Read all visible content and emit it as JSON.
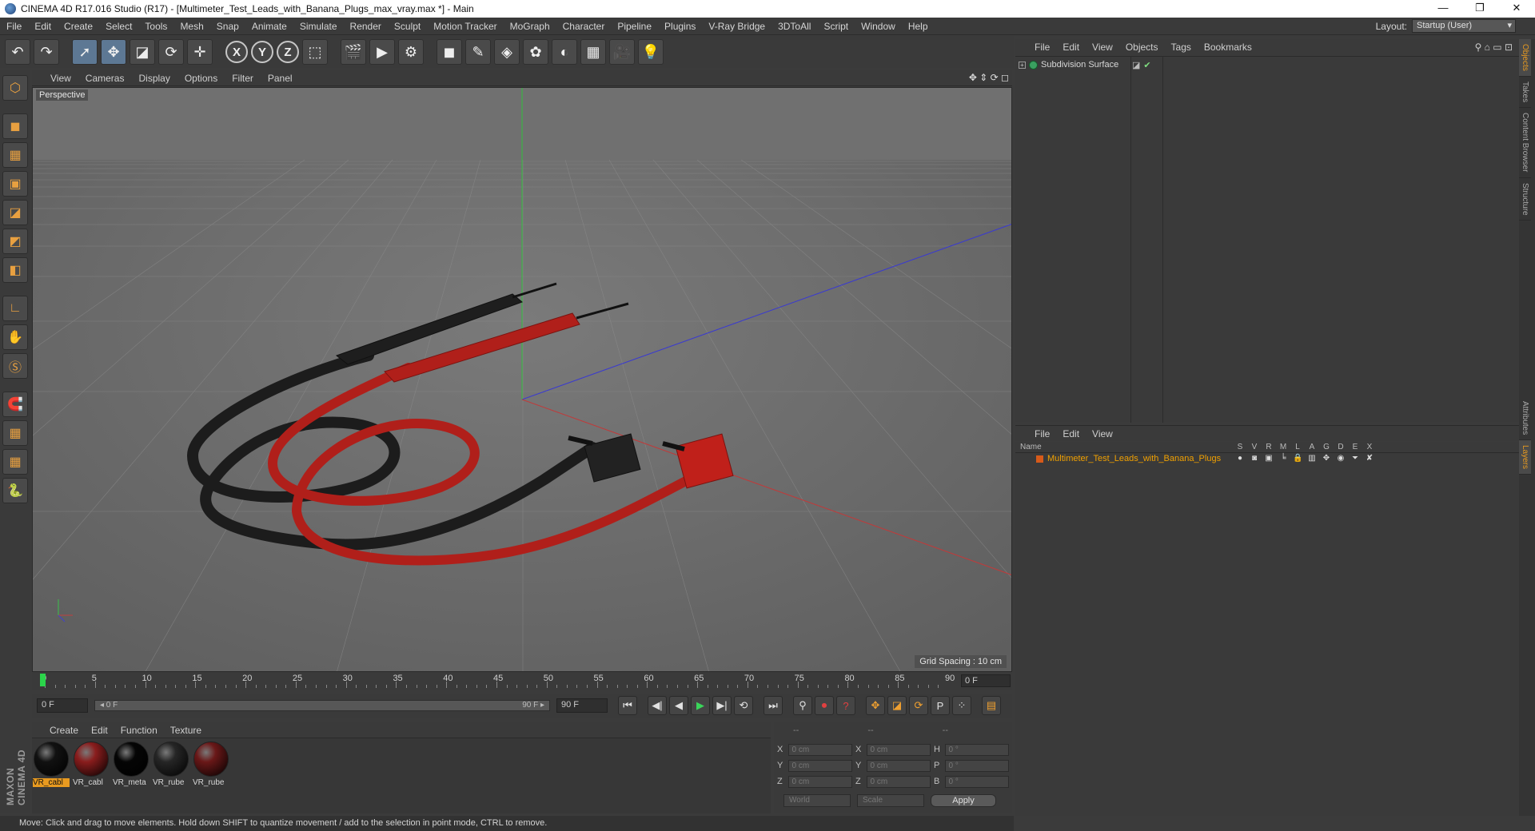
{
  "title_bar": {
    "title": "CINEMA 4D R17.016 Studio (R17) - [Multimeter_Test_Leads_with_Banana_Plugs_max_vray.max *] - Main",
    "minimize": "—",
    "restore": "❐",
    "close": "✕"
  },
  "menu": {
    "items": [
      "File",
      "Edit",
      "Create",
      "Select",
      "Tools",
      "Mesh",
      "Snap",
      "Animate",
      "Simulate",
      "Render",
      "Sculpt",
      "Motion Tracker",
      "MoGraph",
      "Character",
      "Pipeline",
      "Plugins",
      "V-Ray Bridge",
      "3DToAll",
      "Script",
      "Window",
      "Help"
    ],
    "layout_label": "Layout:",
    "layout_value": "Startup (User)"
  },
  "toolbar": {
    "undo": "↶",
    "redo": "↷",
    "select": "➚",
    "move": "✥",
    "scale": "◪",
    "rotate": "⟳",
    "add": "✛",
    "axis_x": "X",
    "axis_y": "Y",
    "axis_z": "Z",
    "coord": "⬚",
    "render_view": "🎬",
    "render_pic": "▶",
    "render_settings": "⚙",
    "cube": "◼",
    "pen": "✎",
    "subdiv": "◈",
    "mograph": "✿",
    "deform": "◐",
    "floor": "▦",
    "camera": "🎥",
    "light": "💡"
  },
  "left_tools": {
    "icons": [
      "⬡",
      "◼",
      "▦",
      "▣",
      "◪",
      "◩",
      "◧",
      "∟",
      "✋",
      "Ⓢ",
      "🧲",
      "▦",
      "▦",
      "🐍"
    ],
    "brand": "MAXON CINEMA 4D"
  },
  "viewport": {
    "menu": [
      "View",
      "Cameras",
      "Display",
      "Options",
      "Filter",
      "Panel"
    ],
    "label": "Perspective",
    "grid_spacing": "Grid Spacing : 10 cm",
    "nav_icons": "✥ ⇕ ⟳ ◻"
  },
  "timeline": {
    "ticks": [
      "0",
      "5",
      "10",
      "15",
      "20",
      "25",
      "30",
      "35",
      "40",
      "45",
      "50",
      "55",
      "60",
      "65",
      "70",
      "75",
      "80",
      "85",
      "90"
    ],
    "current_frame": "0 F"
  },
  "playback": {
    "start": "0 F",
    "range_left": "◂ 0 F",
    "range_right": "90 F ▸",
    "end": "90 F",
    "buttons": [
      "⏮",
      "◀|",
      "◀",
      "▶",
      "▶|",
      "⟲",
      "⏭"
    ],
    "rec_buttons": [
      "⚲",
      "⏺",
      "?",
      "✥",
      "◪",
      "⟳",
      "P",
      "⁘",
      "▤"
    ]
  },
  "material_manager": {
    "menu": [
      "Create",
      "Edit",
      "Function",
      "Texture"
    ],
    "materials": [
      {
        "name": "VR_cabl",
        "color": "#111111",
        "selected": true
      },
      {
        "name": "VR_cabl",
        "color": "#8a1d1d",
        "selected": false
      },
      {
        "name": "VR_meta",
        "color": "#050505",
        "selected": false
      },
      {
        "name": "VR_rube",
        "color": "#262626",
        "selected": false
      },
      {
        "name": "VR_rube",
        "color": "#6a1818",
        "selected": false
      }
    ]
  },
  "coordinates": {
    "header": [
      "--",
      "--",
      "--"
    ],
    "rows": [
      {
        "l1": "X",
        "v1": "0 cm",
        "l2": "X",
        "v2": "0 cm",
        "l3": "H",
        "v3": "0 °"
      },
      {
        "l1": "Y",
        "v1": "0 cm",
        "l2": "Y",
        "v2": "0 cm",
        "l3": "P",
        "v3": "0 °"
      },
      {
        "l1": "Z",
        "v1": "0 cm",
        "l2": "Z",
        "v2": "0 cm",
        "l3": "B",
        "v3": "0 °"
      }
    ],
    "world": "World",
    "scale": "Scale",
    "apply": "Apply"
  },
  "status": "Move: Click and drag to move elements. Hold down SHIFT to quantize movement / add to the selection in point mode, CTRL to remove.",
  "object_manager": {
    "menu": [
      "File",
      "Edit",
      "View",
      "Objects",
      "Tags",
      "Bookmarks"
    ],
    "object_name": "Subdivision Surface",
    "icons": "⚲ ⌂ ▭ ⊡"
  },
  "right_tabs": [
    "Objects",
    "Takes",
    "Content Browser",
    "Structure",
    "Attributes",
    "Layers"
  ],
  "layer_manager": {
    "menu": [
      "File",
      "Edit",
      "View"
    ],
    "col_name": "Name",
    "col_flags": [
      "S",
      "V",
      "R",
      "M",
      "L",
      "A",
      "G",
      "D",
      "E",
      "X"
    ],
    "layer_name": "Multimeter_Test_Leads_with_Banana_Plugs",
    "layer_color": "#d65a1a"
  },
  "colors": {
    "accent": "#e89a20",
    "viewport_bg": "#717171",
    "lead_red": "#b01f1a",
    "lead_black": "#1e1e1e"
  }
}
